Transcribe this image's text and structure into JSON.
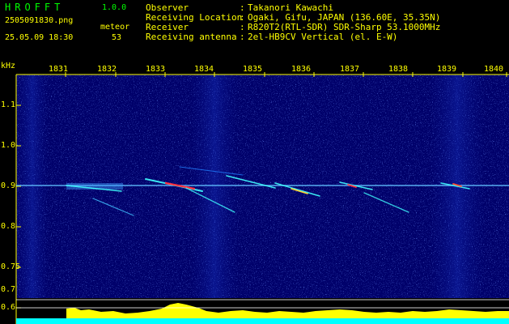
{
  "colors": {
    "label_green": "#00ff00",
    "value_yellow": "#ffff00",
    "text_white": "#ffffff",
    "axis_yellow": "#ffff00",
    "spectrum_bg": "#000070",
    "noise_blue": "#3050ff",
    "echo_cyan": "#40ffff",
    "echo_red": "#ff3040",
    "level_yellow": "#ffff00",
    "level_cyan": "#00ffff",
    "grid_white": "#ffffff"
  },
  "header": {
    "app_name": "HROFFT",
    "version": "1.0.0",
    "filename": "2505091830.png",
    "meteor_label": "meteor",
    "datetime": "25.05.09 18:30",
    "meteor_count": "53"
  },
  "station_info": [
    {
      "label": "Observer",
      "value": "Takanori Kawachi"
    },
    {
      "label": "Receiving Location",
      "value": "Ogaki, Gifu, JAPAN (136.60E, 35.35N)"
    },
    {
      "label": "Receiver",
      "value": "R820T2(RTL-SDR) SDR-Sharp 53.1000MHz"
    },
    {
      "label": "Receiving antenna",
      "value": "2el-HB9CV Vertical (el. E-W)"
    }
  ],
  "info_separator": ":",
  "axis": {
    "unit_label": "kHz",
    "x_ticks": [
      "1831",
      "1832",
      "1833",
      "1834",
      "1835",
      "1836",
      "1837",
      "1838",
      "1839",
      "1840"
    ],
    "y_ticks": [
      "1.1",
      "1.0",
      "0.9",
      "0.8",
      "0.75",
      "0.7",
      "0.6"
    ]
  }
}
